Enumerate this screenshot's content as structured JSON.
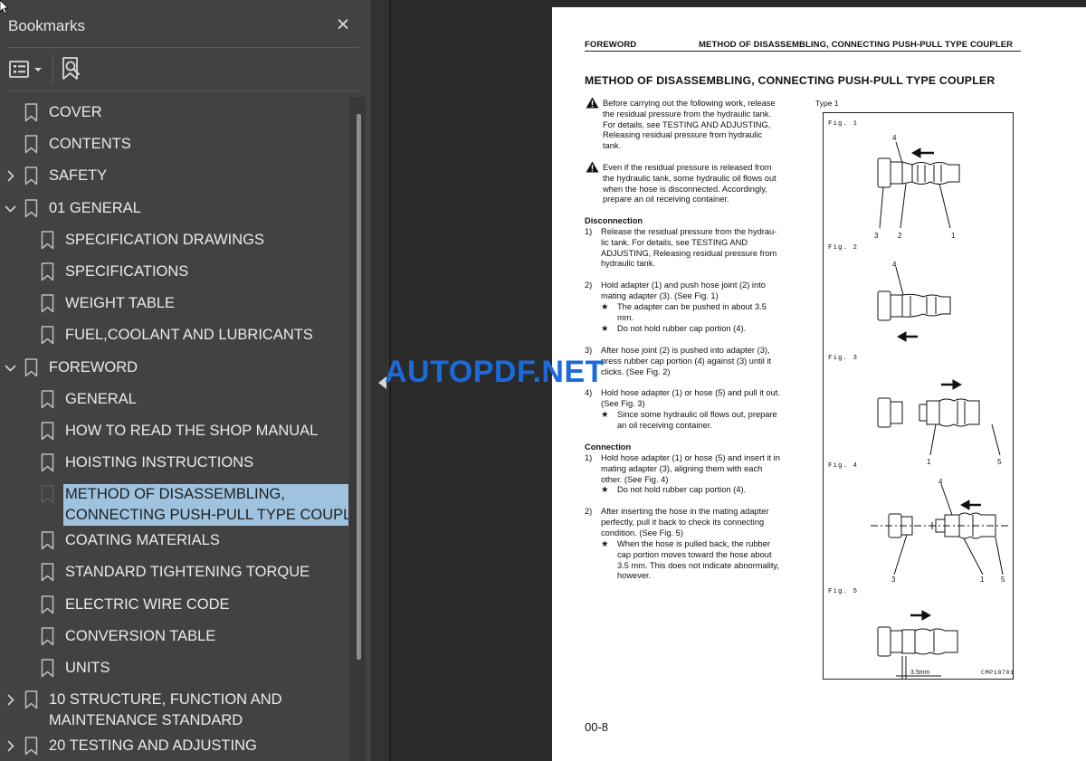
{
  "panel": {
    "title": "Bookmarks",
    "close_glyph": "×"
  },
  "bookmarks": [
    {
      "label": "COVER",
      "level": 0,
      "expander": "none"
    },
    {
      "label": "CONTENTS",
      "level": 0,
      "expander": "none"
    },
    {
      "label": "SAFETY",
      "level": 0,
      "expander": "collapsed"
    },
    {
      "label": "01 GENERAL",
      "level": 0,
      "expander": "expanded"
    },
    {
      "label": "SPECIFICATION DRAWINGS",
      "level": 1,
      "expander": "none"
    },
    {
      "label": "SPECIFICATIONS",
      "level": 1,
      "expander": "none"
    },
    {
      "label": "WEIGHT TABLE",
      "level": 1,
      "expander": "none"
    },
    {
      "label": "FUEL,COOLANT AND LUBRICANTS",
      "level": 1,
      "expander": "none"
    },
    {
      "label": "FOREWORD",
      "level": 0,
      "expander": "expanded"
    },
    {
      "label": "GENERAL",
      "level": 1,
      "expander": "none"
    },
    {
      "label": "HOW TO READ THE SHOP MANUAL",
      "level": 1,
      "expander": "none"
    },
    {
      "label": "HOISTING INSTRUCTIONS",
      "level": 1,
      "expander": "none"
    },
    {
      "label": "METHOD OF DISASSEMBLING,",
      "label2": "CONNECTING PUSH-PULL TYPE COUPLER",
      "level": 1,
      "expander": "none",
      "selected": true
    },
    {
      "label": "COATING MATERIALS",
      "level": 1,
      "expander": "none"
    },
    {
      "label": "STANDARD TIGHTENING TORQUE",
      "level": 1,
      "expander": "none"
    },
    {
      "label": "ELECTRIC WIRE CODE",
      "level": 1,
      "expander": "none"
    },
    {
      "label": "CONVERSION TABLE",
      "level": 1,
      "expander": "none"
    },
    {
      "label": "UNITS",
      "level": 1,
      "expander": "none"
    },
    {
      "label": "10 STRUCTURE, FUNCTION AND",
      "label2": "MAINTENANCE STANDARD",
      "level": 0,
      "expander": "collapsed"
    },
    {
      "label": "20 TESTING AND ADJUSTING",
      "level": 0,
      "expander": "collapsed"
    }
  ],
  "document": {
    "header_left": "FOREWORD",
    "header_right": "METHOD OF DISASSEMBLING, CONNECTING PUSH-PULL TYPE COUPLER",
    "section_title": "METHOD OF DISASSEMBLING, CONNECTING PUSH-PULL TYPE COUPLER",
    "warning1": [
      "Before carrying out the following work, release",
      "the residual pressure from the hydraulic tank.",
      "For details, see TESTING AND ADJUSTING,",
      "Releasing residual pressure from hydraulic",
      "tank."
    ],
    "warning2": [
      "Even if the residual pressure is released from",
      "the hydraulic tank, some hydraulic oil flows out",
      "when the hose is disconnected.  Accordingly,",
      "prepare an oil receiving container."
    ],
    "disconnection": {
      "heading": "Disconnection",
      "step1_num": "1)",
      "step1": [
        "Release the residual pressure from the hydrau-",
        "lic tank.  For details, see TESTING AND",
        "ADJUSTING, Releasing residual pressure from",
        "hydraulic tank."
      ],
      "step2_num": "2)",
      "step2": [
        "Hold adapter (1) and push hose joint (2) into",
        "mating adapter (3).  (See Fig. 1)"
      ],
      "step2_note1": [
        "The adapter can be pushed in about 3.5",
        "mm."
      ],
      "step2_note2": [
        "Do not hold rubber cap portion (4)."
      ],
      "step3_num": "3)",
      "step3": [
        "After hose joint (2) is pushed into adapter (3),",
        "press rubber cap portion (4) against (3) until it",
        "clicks.  (See Fig. 2)"
      ],
      "step4_num": "4)",
      "step4": [
        "Hold hose adapter (1) or hose (5) and pull it out.",
        "(See Fig. 3)"
      ],
      "step4_note": [
        "Since some hydraulic oil flows out, prepare",
        "an oil receiving container."
      ]
    },
    "connection": {
      "heading": "Connection",
      "step1_num": "1)",
      "step1": [
        "Hold hose adapter (1) or hose (5) and insert it in",
        "mating adapter (3), aligning them with each",
        "other.  (See Fig. 4)"
      ],
      "step1_note": [
        "Do not hold rubber cap portion (4)."
      ],
      "step2_num": "2)",
      "step2": [
        "After inserting the hose in the mating adapter",
        "perfectly, pull it back to check its connecting",
        "condition.  (See Fig. 5)"
      ],
      "step2_note": [
        "When the hose is pulled back, the rubber",
        "cap portion moves toward the hose about",
        "3.5 mm.  This does not indicate abnormality,",
        "however."
      ]
    },
    "star": "★",
    "type_label": "Type 1",
    "fig_labels": [
      "Fig. 1",
      "Fig. 2",
      "Fig. 3",
      "Fig. 4",
      "Fig. 5"
    ],
    "fig_callouts": {
      "n1": "1",
      "n2": "2",
      "n3": "3",
      "n4": "4",
      "n5": "5"
    },
    "fig_dimension": "3.5mm",
    "fig_code": "CMP10701",
    "page_number": "00-8"
  },
  "watermark": "AUTOPDF.NET",
  "colors": {
    "panel_bg": "#424242",
    "selection": "#9fc3de",
    "watermark": "#1a6bd9",
    "app_bg": "#2b2b2b"
  },
  "icons": {
    "close": "close-icon",
    "options": "list-options-icon",
    "find": "find-bookmark-icon",
    "bookmark": "bookmark-ribbon-icon",
    "expand": "chevron-right-icon",
    "collapse": "chevron-down-icon",
    "warning": "warning-triangle-icon"
  }
}
